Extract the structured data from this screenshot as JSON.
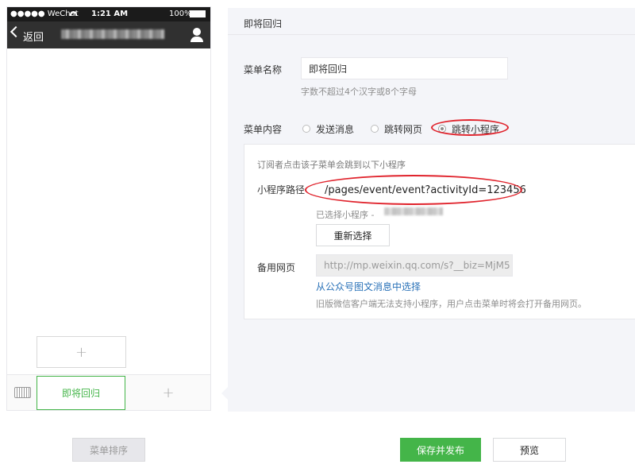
{
  "phone": {
    "status": {
      "carrier": "●●●●● WeChat",
      "time": "1:21 AM",
      "battery": "100%"
    },
    "nav": {
      "back_label": "返回"
    },
    "menu_bar": {
      "active_item": "即将回归"
    }
  },
  "editor": {
    "header_title": "即将回归",
    "menu_name": {
      "label": "菜单名称",
      "value": "即将回归",
      "hint": "字数不超过4个汉字或8个字母"
    },
    "menu_content": {
      "label": "菜单内容",
      "options": [
        "发送消息",
        "跳转网页",
        "跳转小程序"
      ],
      "selected": "跳转小程序"
    },
    "miniprogram": {
      "description": "订阅者点击该子菜单会跳到以下小程序",
      "path_label": "小程序路径",
      "path_value": "/pages/event/event?activityId=123456",
      "selected_label": "已选择小程序 -",
      "reselect_button": "重新选择"
    },
    "backup_page": {
      "label": "备用网页",
      "url_value": "http://mp.weixin.qq.com/s?__biz=MjM5",
      "select_link": "从公众号图文消息中选择",
      "note": "旧版微信客户端无法支持小程序，用户点击菜单时将会打开备用网页。"
    }
  },
  "toolbar": {
    "sort_label": "菜单排序",
    "save_label": "保存并发布",
    "preview_label": "预览"
  },
  "colors": {
    "accent_green": "#44b549",
    "link_blue": "#2a72b8",
    "annotation_red": "#e0232c"
  },
  "icons": [
    "wifi-icon",
    "battery-icon",
    "back-chevron-icon",
    "person-icon",
    "keyboard-icon",
    "plus-icon"
  ]
}
